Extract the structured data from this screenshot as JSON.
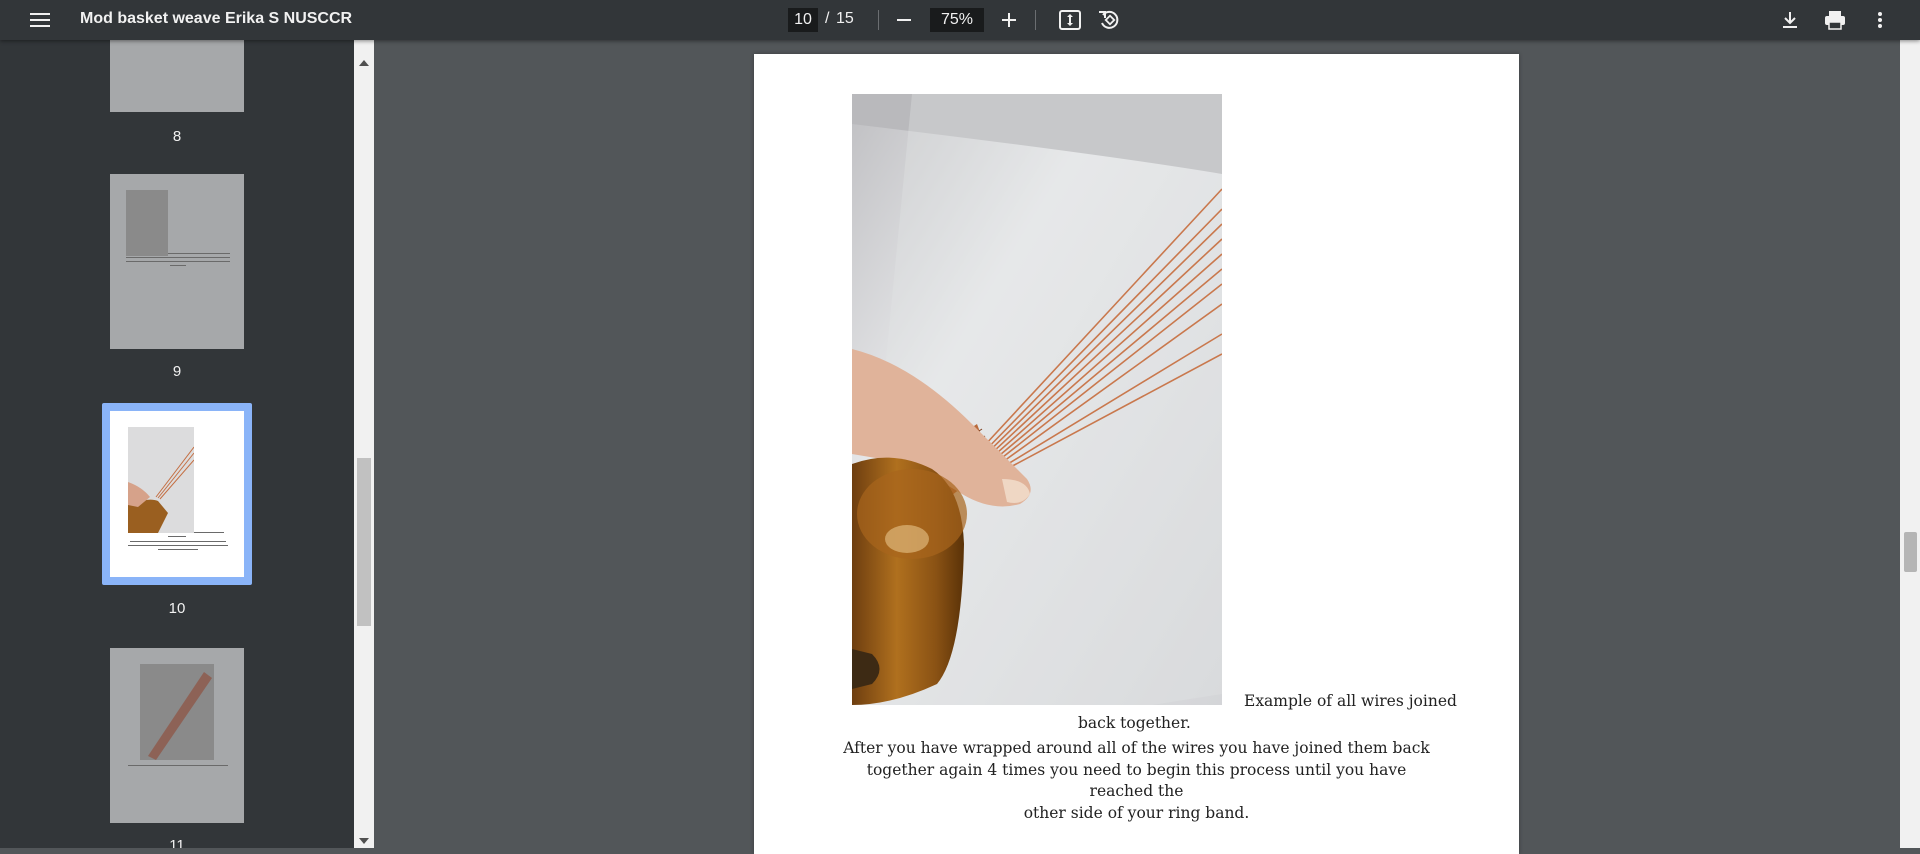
{
  "toolbar": {
    "title": "Mod basket weave Erika S NUSCCR",
    "current_page": "10",
    "page_separator": "/",
    "total_pages": "15",
    "zoom": "75%",
    "icons": {
      "menu": "hamburger-menu-icon",
      "zoom_out": "minus-icon",
      "zoom_in": "plus-icon",
      "fit": "fit-to-page-icon",
      "rotate": "rotate-counterclockwise-icon",
      "download": "download-icon",
      "print": "printer-icon",
      "more": "more-vertical-icon"
    }
  },
  "sidebar": {
    "thumbnails": [
      {
        "label": "8"
      },
      {
        "label": "9"
      },
      {
        "label": "10",
        "selected": true
      },
      {
        "label": "11"
      }
    ]
  },
  "page": {
    "caption_line1": "Example of all wires joined",
    "caption_line2": "back together.",
    "body_lines": [
      "After you have wrapped around all of the wires you have joined them back",
      "together again 4 times you need to begin this process until you have reached the",
      "other side of your ring band."
    ]
  },
  "colors": {
    "toolbar_bg": "#323639",
    "sidebar_bg": "#323639",
    "viewer_bg": "#525659",
    "selected_thumb_border": "#8ab4f8"
  }
}
